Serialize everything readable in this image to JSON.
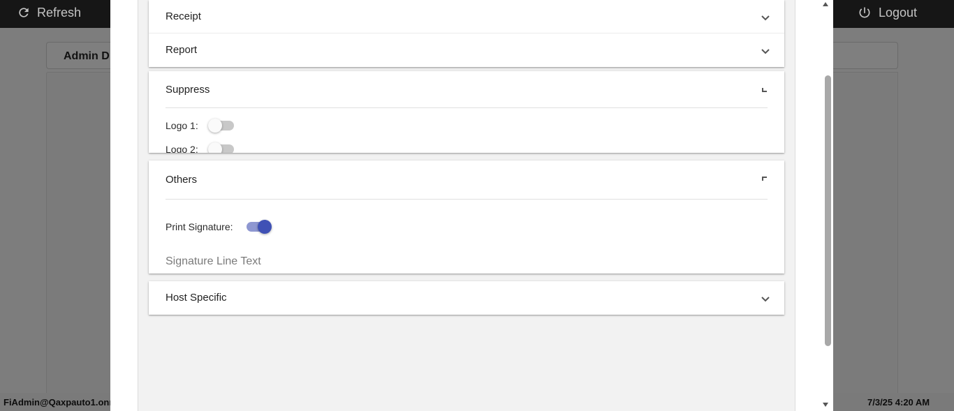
{
  "app": {
    "refresh_label": "Refresh",
    "logout_label": "Logout",
    "background_tab_label": "Admin D",
    "user": "FiAdmin@Qaxpauto1.onr",
    "timestamp": "7/3/25 4:20 AM"
  },
  "panels": {
    "receipt": {
      "title": "Receipt",
      "expanded": false
    },
    "report": {
      "title": "Report",
      "expanded": false
    },
    "suppress": {
      "title": "Suppress",
      "expanded": true,
      "logo1_label": "Logo 1:",
      "logo1_on": false,
      "logo2_label": "Logo 2:",
      "logo2_on": false
    },
    "others": {
      "title": "Others",
      "expanded": true,
      "print_signature_label": "Print Signature:",
      "print_signature_on": true,
      "signature_placeholder": "Signature Line Text",
      "signature_value": ""
    },
    "host_specific": {
      "title": "Host Specific",
      "expanded": false
    }
  },
  "colors": {
    "toggle_on_thumb": "#3f51b5",
    "toggle_on_track": "#8e97d1",
    "topbar": "#161616"
  },
  "icons": {
    "refresh": "refresh-icon",
    "logout": "power-icon",
    "collapsed": "chevron-down-icon",
    "expanded": "chevron-up-icon"
  }
}
